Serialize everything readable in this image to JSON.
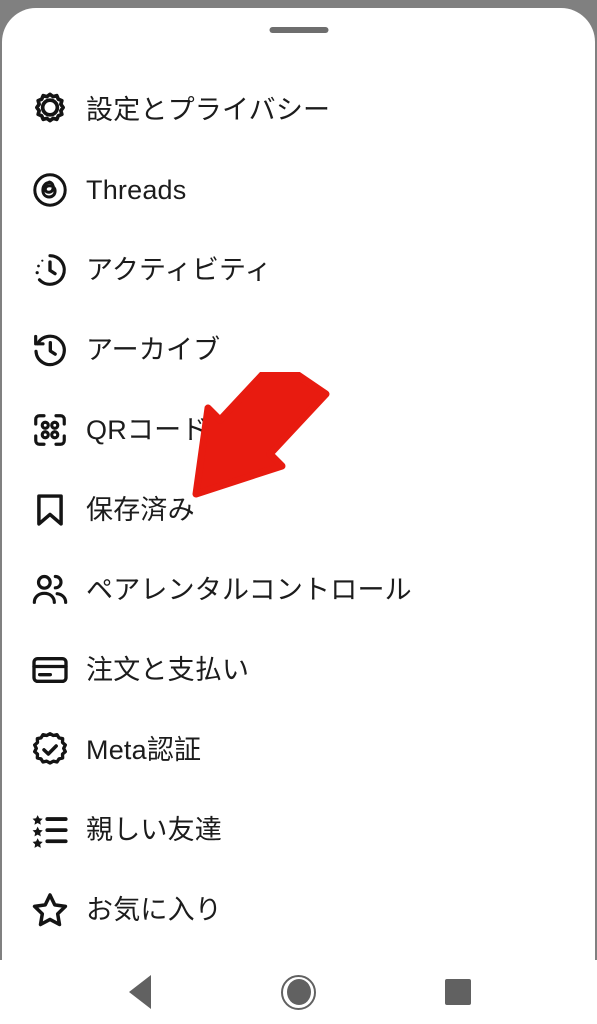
{
  "sheet": {
    "drag_handle": "drag-handle",
    "background_color": "#ffffff",
    "backdrop_color": "#808080"
  },
  "menu": {
    "items": [
      {
        "icon": "gear-icon",
        "label": "設定とプライバシー"
      },
      {
        "icon": "threads-icon",
        "label": "Threads"
      },
      {
        "icon": "activity-clock-icon",
        "label": "アクティビティ"
      },
      {
        "icon": "archive-clock-icon",
        "label": "アーカイブ"
      },
      {
        "icon": "qr-code-icon",
        "label": "QRコード"
      },
      {
        "icon": "bookmark-icon",
        "label": "保存済み"
      },
      {
        "icon": "people-icon",
        "label": "ペアレンタルコントロール"
      },
      {
        "icon": "credit-card-icon",
        "label": "注文と支払い"
      },
      {
        "icon": "verified-badge-icon",
        "label": "Meta認証"
      },
      {
        "icon": "star-list-icon",
        "label": "親しい友達"
      },
      {
        "icon": "star-icon",
        "label": "お気に入り"
      }
    ]
  },
  "annotation": {
    "type": "arrow",
    "color": "#e81b10",
    "points_to": "保存済み",
    "direction": "down-left"
  },
  "navbar": {
    "back_label": "戻る",
    "home_label": "ホーム",
    "recents_label": "最近のアプリ",
    "color": "#616161"
  }
}
